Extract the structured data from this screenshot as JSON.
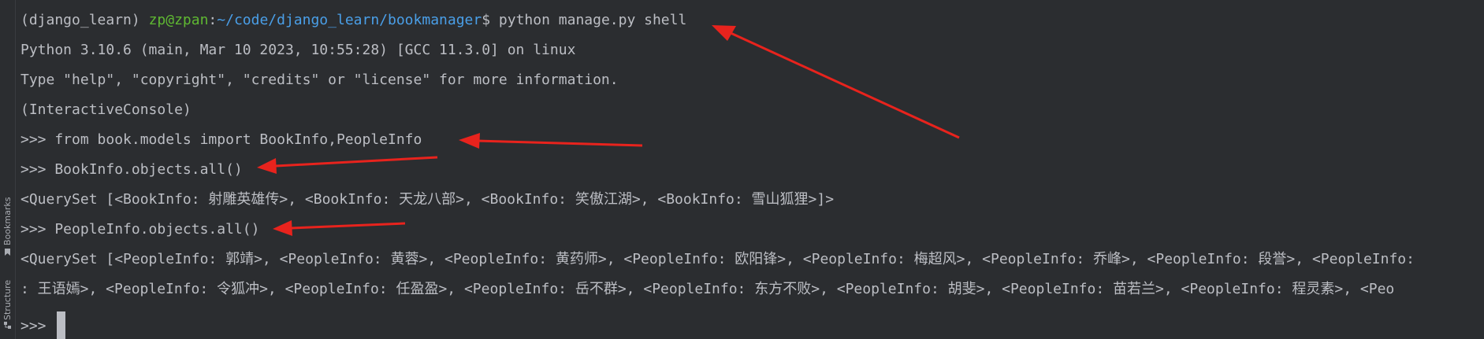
{
  "sidebar": {
    "bookmarks_label": "Bookmarks",
    "structure_label": "Structure",
    "bookmarks_icon": "bookmark-icon",
    "structure_icon": "structure-icon"
  },
  "terminal": {
    "prompt": {
      "venv": "(django_learn)",
      "user_host": "zp@zpan",
      "separator": ":",
      "path": "~/code/django_learn/bookmanager",
      "symbol": "$",
      "command": "python manage.py shell"
    },
    "lines": [
      "Python 3.10.6 (main, Mar 10 2023, 10:55:28) [GCC 11.3.0] on linux",
      "Type \"help\", \"copyright\", \"credits\" or \"license\" for more information.",
      "(InteractiveConsole)",
      ">>> from book.models import BookInfo,PeopleInfo",
      ">>> BookInfo.objects.all()",
      "<QuerySet [<BookInfo: 射雕英雄传>, <BookInfo: 天龙八部>, <BookInfo: 笑傲江湖>, <BookInfo: 雪山狐狸>]>",
      ">>> PeopleInfo.objects.all()",
      "<QuerySet [<PeopleInfo: 郭靖>, <PeopleInfo: 黄蓉>, <PeopleInfo: 黄药师>, <PeopleInfo: 欧阳锋>, <PeopleInfo: 梅超风>, <PeopleInfo: 乔峰>, <PeopleInfo: 段誉>, <PeopleInfo:",
      ": 王语嫣>, <PeopleInfo: 令狐冲>, <PeopleInfo: 任盈盈>, <PeopleInfo: 岳不群>, <PeopleInfo: 东方不败>, <PeopleInfo: 胡斐>, <PeopleInfo: 苗若兰>, <PeopleInfo: 程灵素>, <Peo"
    ],
    "current_prompt": ">>>"
  },
  "colors": {
    "background": "#2b2d30",
    "text": "#bcbec4",
    "user_host": "#5fb832",
    "path": "#4a9fe8",
    "annotation_arrow": "#e8231d"
  }
}
